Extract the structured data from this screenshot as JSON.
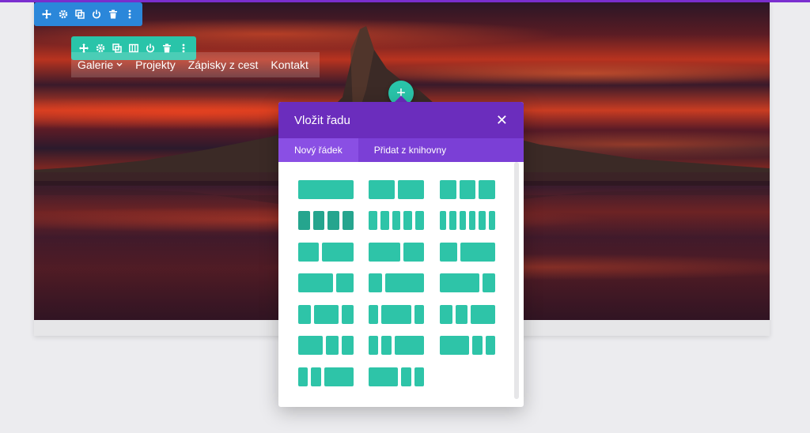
{
  "nav": {
    "items": [
      {
        "label": "Galerie",
        "has_dropdown": true
      },
      {
        "label": "Projekty"
      },
      {
        "label": "Zápisky z cest"
      },
      {
        "label": "Kontakt"
      }
    ]
  },
  "toolbar_section": {
    "icons": [
      "move-icon",
      "settings-icon",
      "duplicate-icon",
      "power-icon",
      "trash-icon",
      "more-icon"
    ]
  },
  "toolbar_row": {
    "icons": [
      "move-icon",
      "settings-icon",
      "duplicate-icon",
      "columns-icon",
      "power-icon",
      "trash-icon",
      "more-icon"
    ]
  },
  "add_button": {
    "label": "+"
  },
  "modal": {
    "title": "Vložit řadu",
    "close_label": "✕",
    "tabs": [
      {
        "label": "Nový řádek",
        "active": true
      },
      {
        "label": "Přidat z knihovny",
        "active": false
      }
    ],
    "layouts": [
      {
        "name": "1",
        "cols": [
          1
        ]
      },
      {
        "name": "1/2+1/2",
        "cols": [
          1,
          1
        ]
      },
      {
        "name": "1/3x3",
        "cols": [
          1,
          1,
          1
        ]
      },
      {
        "name": "1/4x4",
        "cols": [
          1,
          1,
          1,
          1
        ],
        "highlight": true
      },
      {
        "name": "1/5x5",
        "cols": [
          1,
          1,
          1,
          1,
          1
        ]
      },
      {
        "name": "1/6x6",
        "cols": [
          1,
          1,
          1,
          1,
          1,
          1
        ]
      },
      {
        "name": "2/5+3/5",
        "cols": [
          2,
          3
        ]
      },
      {
        "name": "3/5+2/5",
        "cols": [
          3,
          2
        ]
      },
      {
        "name": "1/3+2/3",
        "cols": [
          1,
          2
        ]
      },
      {
        "name": "2/3+1/3",
        "cols": [
          2,
          1
        ]
      },
      {
        "name": "1/4+3/4",
        "cols": [
          1,
          3
        ]
      },
      {
        "name": "3/4+1/4",
        "cols": [
          3,
          1
        ]
      },
      {
        "name": "1/4+1/2+1/4",
        "cols": [
          1,
          2,
          1
        ]
      },
      {
        "name": "1/5+3/5+1/5",
        "cols": [
          1,
          3,
          1
        ]
      },
      {
        "name": "1/4+1/4+1/2",
        "cols": [
          1,
          1,
          2
        ]
      },
      {
        "name": "1/2+1/4+1/4",
        "cols": [
          2,
          1,
          1
        ]
      },
      {
        "name": "1/5+1/5+3/5",
        "cols": [
          1,
          1,
          3
        ]
      },
      {
        "name": "3/5+1/5+1/5",
        "cols": [
          3,
          1,
          1
        ]
      },
      {
        "name": "1/6x2+1/2",
        "cols": [
          1,
          1,
          3
        ]
      },
      {
        "name": "1/2+1/6x2",
        "cols": [
          3,
          1,
          1
        ]
      }
    ]
  },
  "colors": {
    "accent_purple": "#6b2dbd",
    "tab_bar": "#7b3fd6",
    "teal": "#29c4a9",
    "blue": "#2b87da"
  }
}
